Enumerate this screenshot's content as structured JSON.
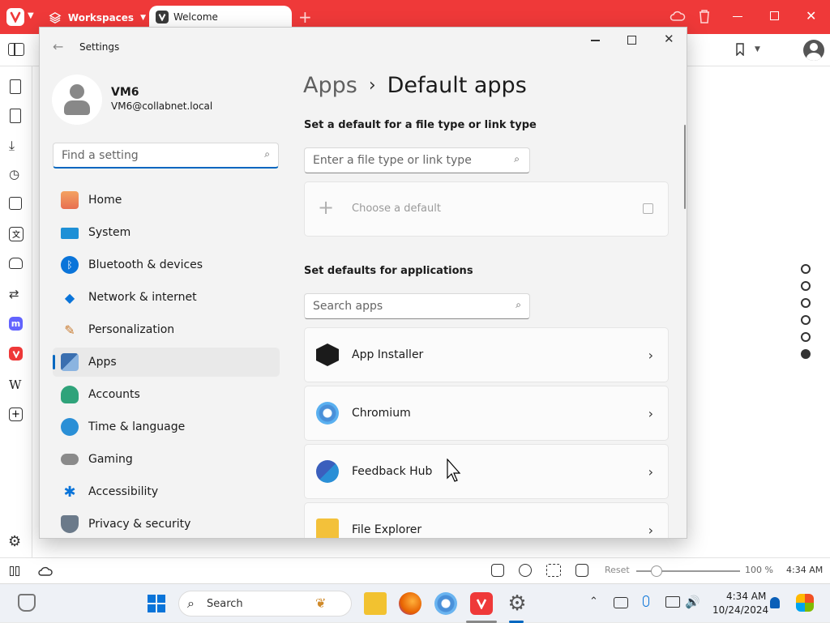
{
  "browser": {
    "workspaces_label": "Workspaces",
    "tab_title": "Welcome",
    "status": {
      "reset_label": "Reset",
      "zoom": "100 %",
      "time": "4:34 AM"
    }
  },
  "settings": {
    "window_title": "Settings",
    "user": {
      "name": "VM6",
      "email": "VM6@collabnet.local"
    },
    "search_placeholder": "Find a setting",
    "nav": [
      {
        "label": "Home",
        "icon": "home-icon"
      },
      {
        "label": "System",
        "icon": "system-icon"
      },
      {
        "label": "Bluetooth & devices",
        "icon": "bluetooth-icon"
      },
      {
        "label": "Network & internet",
        "icon": "wifi-icon"
      },
      {
        "label": "Personalization",
        "icon": "brush-icon"
      },
      {
        "label": "Apps",
        "icon": "apps-icon",
        "active": true
      },
      {
        "label": "Accounts",
        "icon": "accounts-icon"
      },
      {
        "label": "Time & language",
        "icon": "globe-clock-icon"
      },
      {
        "label": "Gaming",
        "icon": "gamepad-icon"
      },
      {
        "label": "Accessibility",
        "icon": "accessibility-icon"
      },
      {
        "label": "Privacy & security",
        "icon": "shield-icon"
      }
    ],
    "breadcrumb_parent": "Apps",
    "breadcrumb_sep": "›",
    "page_title": "Default apps",
    "section1_title": "Set a default for a file type or link type",
    "filetype_placeholder": "Enter a file type or link type",
    "choose_default": "Choose a default",
    "section2_title": "Set defaults for applications",
    "apps_search_placeholder": "Search apps",
    "apps": [
      {
        "name": "App Installer",
        "icon": "app-installer-icon"
      },
      {
        "name": "Chromium",
        "icon": "chromium-icon"
      },
      {
        "name": "Feedback Hub",
        "icon": "feedback-hub-icon"
      },
      {
        "name": "File Explorer",
        "icon": "file-explorer-icon"
      }
    ]
  },
  "taskbar": {
    "search_label": "Search",
    "clock_time": "4:34 AM",
    "clock_date": "10/24/2024"
  },
  "colors": {
    "vivaldi_red": "#ef3939",
    "accent": "#0067c0"
  }
}
